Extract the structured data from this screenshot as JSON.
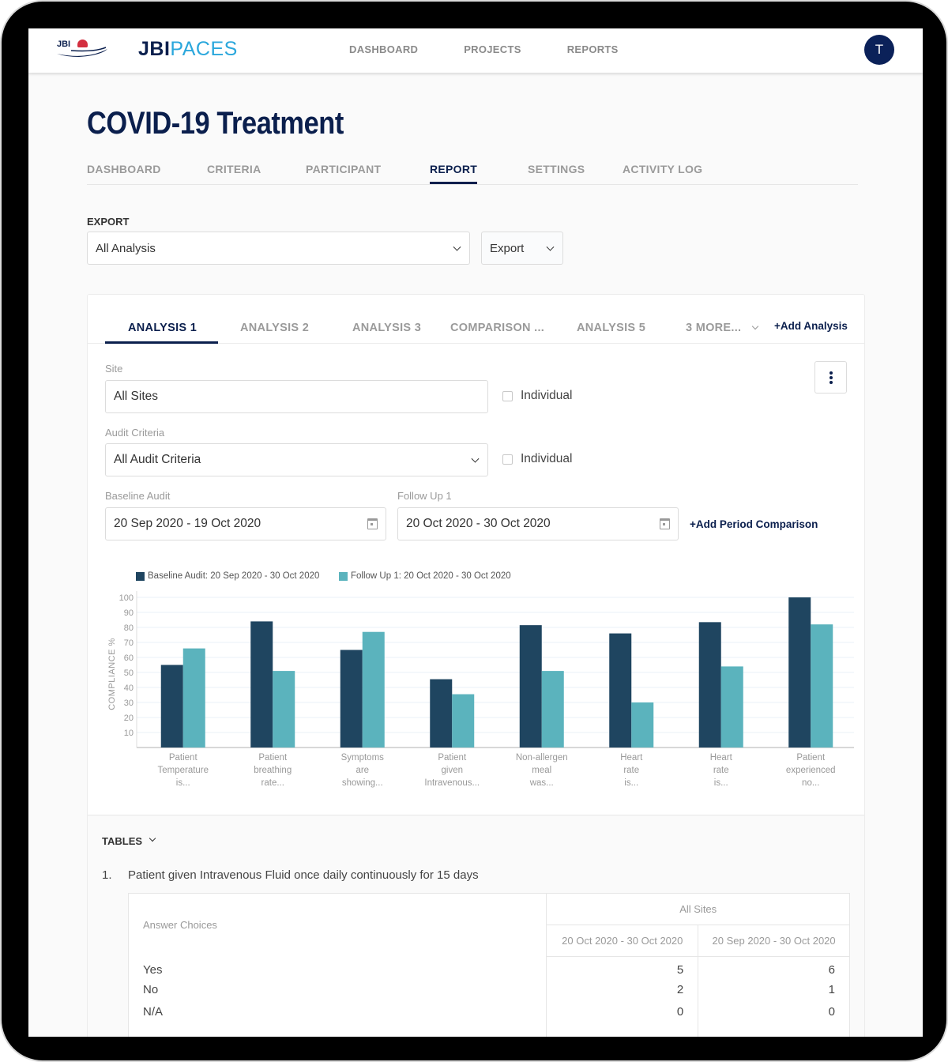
{
  "app": {
    "logo_small": "JBI",
    "brand_part1": "JBI",
    "brand_part2": "PACES",
    "nav": [
      "DASHBOARD",
      "PROJECTS",
      "REPORTS"
    ],
    "avatar_initial": "T"
  },
  "page": {
    "title": "COVID-19 Treatment",
    "tabs": [
      {
        "label": "DASHBOARD",
        "active": false
      },
      {
        "label": "CRITERIA",
        "active": false
      },
      {
        "label": "PARTICIPANT",
        "active": false
      },
      {
        "label": "REPORT",
        "active": true
      },
      {
        "label": "SETTINGS",
        "active": false
      },
      {
        "label": "ACTIVITY LOG",
        "active": false
      }
    ]
  },
  "export": {
    "label": "EXPORT",
    "scope_value": "All Analysis",
    "button_label": "Export"
  },
  "analysis": {
    "tabs": [
      {
        "label": "ANALYSIS 1",
        "active": true
      },
      {
        "label": "ANALYSIS 2",
        "active": false
      },
      {
        "label": "ANALYSIS 3",
        "active": false
      },
      {
        "label": "COMPARISON ...",
        "active": false
      },
      {
        "label": "ANALYSIS 5",
        "active": false
      },
      {
        "label": "3 MORE...",
        "active": false
      }
    ],
    "add_label": "+Add Analysis",
    "site_label": "Site",
    "site_value": "All Sites",
    "individual_label": "Individual",
    "criteria_label": "Audit Criteria",
    "criteria_value": "All Audit Criteria",
    "baseline_label": "Baseline Audit",
    "baseline_value": "20 Sep 2020 - 19 Oct 2020",
    "followup_label": "Follow Up 1",
    "followup_value": "20 Oct 2020 - 30 Oct 2020",
    "add_period_label": "+Add Period Comparison"
  },
  "colors": {
    "baseline": "#1f4560",
    "followup": "#5bb3bd",
    "primary": "#0b1f4d"
  },
  "chart_data": {
    "type": "bar",
    "title": "",
    "xlabel": "",
    "ylabel": "COMPLIANCE %",
    "ylim": [
      0,
      100
    ],
    "yticks": [
      10,
      20,
      30,
      40,
      50,
      60,
      70,
      80,
      90,
      100
    ],
    "grid": true,
    "legend_position": "top-left",
    "categories": [
      [
        "Patient",
        "Temperature",
        "is..."
      ],
      [
        "Patient",
        "breathing",
        "rate..."
      ],
      [
        "Symptoms",
        "are",
        "showing..."
      ],
      [
        "Patient",
        "given",
        "Intravenous..."
      ],
      [
        "Non-allergen",
        "meal",
        "was..."
      ],
      [
        "Heart",
        "rate",
        "is..."
      ],
      [
        "Heart",
        "rate",
        "is..."
      ],
      [
        "Patient",
        "experienced",
        "no..."
      ]
    ],
    "series": [
      {
        "name": "Baseline Audit: 20 Sep 2020 - 30 Oct 2020",
        "values": [
          55,
          84,
          65,
          45.5,
          81.5,
          76,
          83.5,
          100
        ]
      },
      {
        "name": "Follow Up 1: 20 Oct 2020 - 30 Oct 2020",
        "values": [
          66,
          51,
          77,
          35.5,
          51,
          30,
          54,
          82
        ]
      }
    ]
  },
  "tables": {
    "title": "TABLES",
    "question_number": "1.",
    "question_text": "Patient given Intravenous Fluid once daily continuously for 15 days",
    "answer_header": "Answer Choices",
    "group_header": "All Sites",
    "period_headers": [
      "20 Oct 2020 - 30 Oct 2020",
      "20 Sep 2020 - 30 Oct 2020"
    ],
    "rows": [
      {
        "choice": "Yes",
        "values": [
          "5",
          "6"
        ]
      },
      {
        "choice": "No",
        "values": [
          "2",
          "1"
        ]
      },
      {
        "choice": "N/A",
        "values": [
          "0",
          "0"
        ]
      }
    ]
  }
}
